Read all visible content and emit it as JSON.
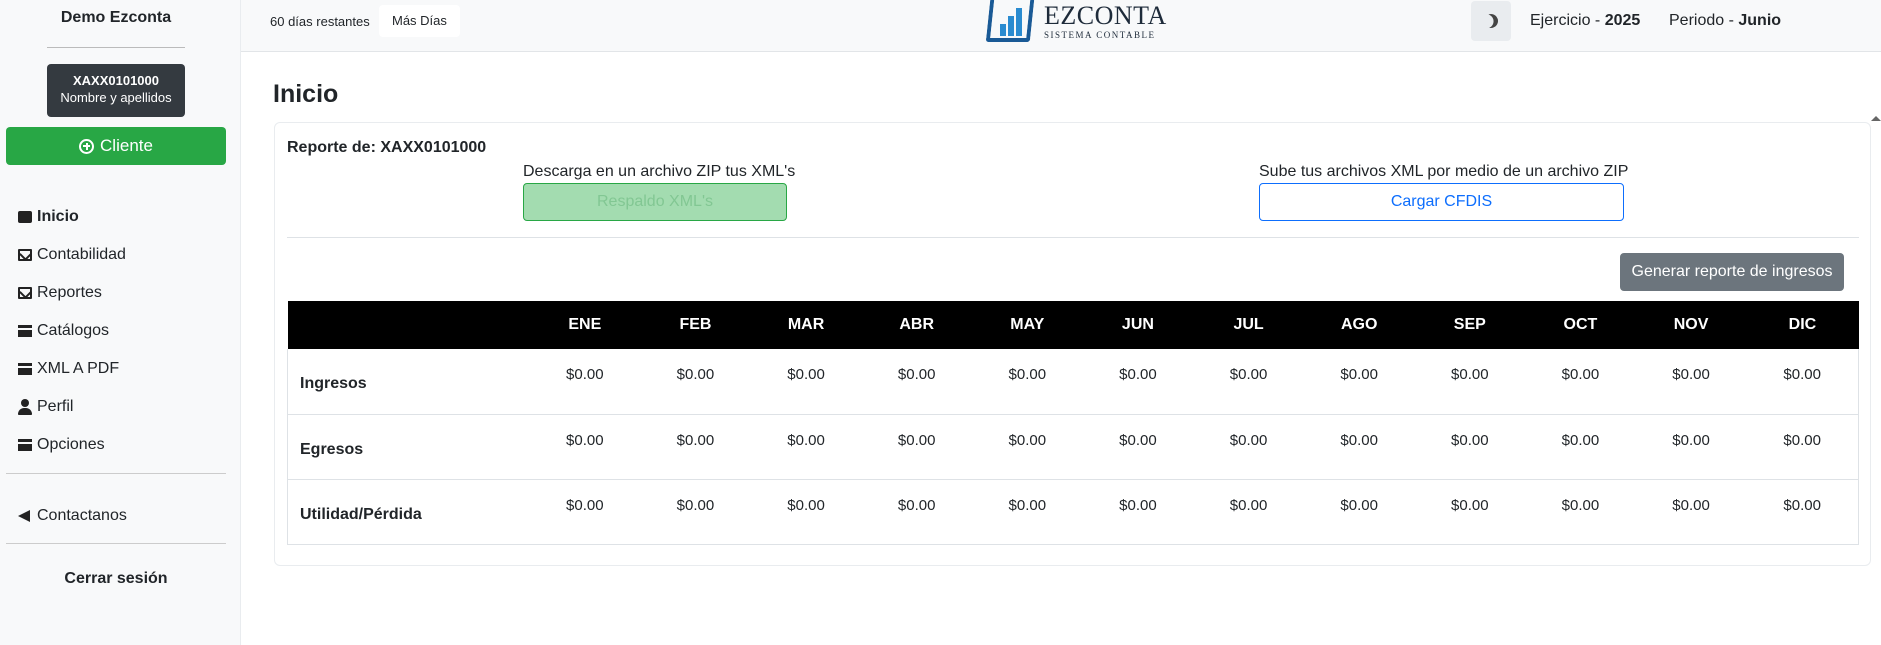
{
  "sidebar": {
    "brand": "Demo Ezconta",
    "user": {
      "rfc": "XAXX0101000",
      "name": "Nombre y apellidos"
    },
    "client_button": "Cliente",
    "nav": [
      {
        "label": "Inicio",
        "icon": "home-icon"
      },
      {
        "label": "Contabilidad",
        "icon": "envelope-open-icon"
      },
      {
        "label": "Reportes",
        "icon": "envelope-open-icon"
      },
      {
        "label": "Catálogos",
        "icon": "archive-icon"
      },
      {
        "label": "XML A PDF",
        "icon": "archive-icon"
      },
      {
        "label": "Perfil",
        "icon": "user-icon"
      },
      {
        "label": "Opciones",
        "icon": "archive-icon"
      }
    ],
    "contact": "Contactanos",
    "logout": "Cerrar sesión"
  },
  "topbar": {
    "days_remaining": "60 días restantes",
    "more_days": "Más Días",
    "logo_title": "EZCONTA",
    "logo_subtitle": "SISTEMA CONTABLE",
    "ejercicio_label": "Ejercicio - ",
    "ejercicio_value": "2025",
    "periodo_label": "Periodo - ",
    "periodo_value": "Junio"
  },
  "main": {
    "title": "Inicio",
    "report_of": "Reporte de: XAXX0101000",
    "download_label": "Descarga en un archivo ZIP tus XML's",
    "download_button": "Respaldo XML's",
    "upload_label": "Sube tus archivos XML por medio de un archivo ZIP",
    "upload_button": "Cargar CFDIS",
    "generate_button": "Generar reporte de ingresos",
    "table": {
      "months": [
        "ENE",
        "FEB",
        "MAR",
        "ABR",
        "MAY",
        "JUN",
        "JUL",
        "AGO",
        "SEP",
        "OCT",
        "NOV",
        "DIC"
      ],
      "rows": [
        {
          "label": "Ingresos",
          "values": [
            "$0.00",
            "$0.00",
            "$0.00",
            "$0.00",
            "$0.00",
            "$0.00",
            "$0.00",
            "$0.00",
            "$0.00",
            "$0.00",
            "$0.00",
            "$0.00"
          ]
        },
        {
          "label": "Egresos",
          "values": [
            "$0.00",
            "$0.00",
            "$0.00",
            "$0.00",
            "$0.00",
            "$0.00",
            "$0.00",
            "$0.00",
            "$0.00",
            "$0.00",
            "$0.00",
            "$0.00"
          ]
        },
        {
          "label": "Utilidad/Pérdida",
          "values": [
            "$0.00",
            "$0.00",
            "$0.00",
            "$0.00",
            "$0.00",
            "$0.00",
            "$0.00",
            "$0.00",
            "$0.00",
            "$0.00",
            "$0.00",
            "$0.00"
          ]
        }
      ]
    }
  },
  "colors": {
    "success": "#28a745",
    "primary": "#0d6efd",
    "secondary": "#6c757d",
    "dark": "#343a40"
  }
}
